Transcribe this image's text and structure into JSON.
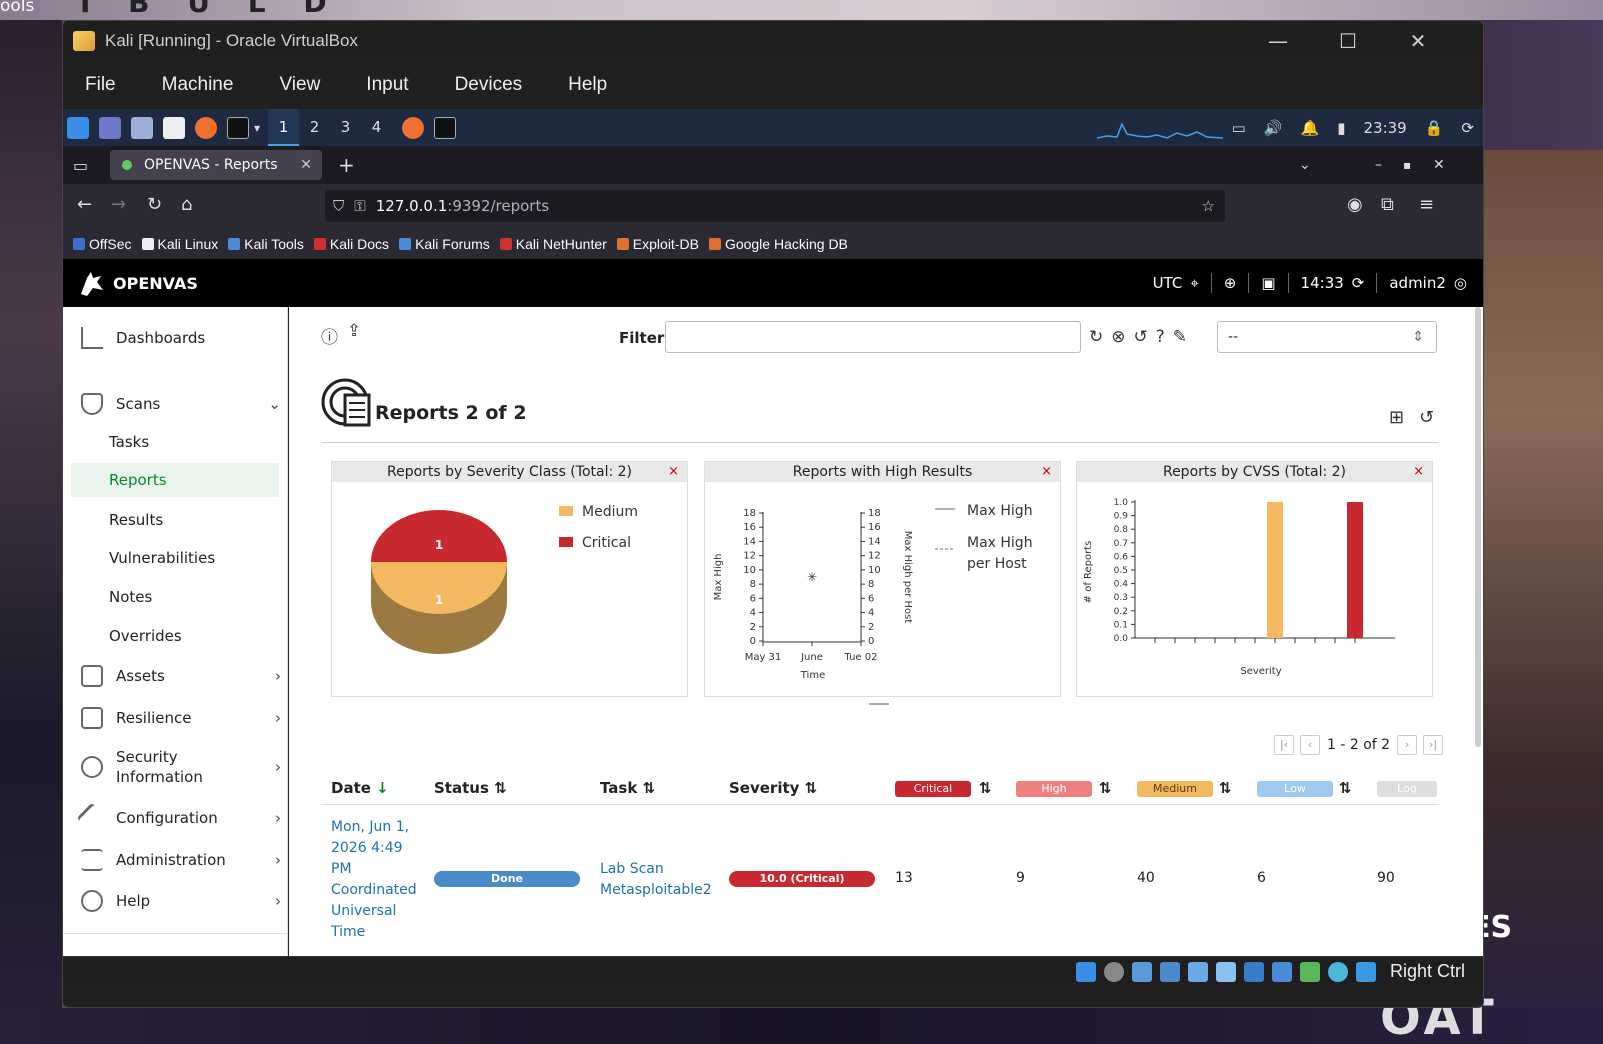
{
  "background": {
    "corner_text": "ools",
    "banner_text": "I B U L D",
    "right_text": "ES",
    "bottom_text": "OAT"
  },
  "window": {
    "title": "Kali [Running] - Oracle VirtualBox",
    "minimize": "—",
    "maximize": "☐",
    "close": "✕"
  },
  "menu": [
    "File",
    "Machine",
    "View",
    "Input",
    "Devices",
    "Help"
  ],
  "kali_panel": {
    "workspaces": [
      "1",
      "2",
      "3",
      "4"
    ],
    "clock": "23:39"
  },
  "browser": {
    "tab_title": "OPENVAS - Reports",
    "tab_close": "✕",
    "new_tab": "+",
    "url_host": "127.0.0.1",
    "url_path": ":9392/reports",
    "bookmarks": [
      {
        "label": "OffSec",
        "color": "#3a6fd0"
      },
      {
        "label": "Kali Linux",
        "color": "#eee"
      },
      {
        "label": "Kali Tools",
        "color": "#4a8ad8"
      },
      {
        "label": "Kali Docs",
        "color": "#d03030"
      },
      {
        "label": "Kali Forums",
        "color": "#4a8ad8"
      },
      {
        "label": "Kali NetHunter",
        "color": "#d03030"
      },
      {
        "label": "Exploit-DB",
        "color": "#e07030"
      },
      {
        "label": "Google Hacking DB",
        "color": "#e07030"
      }
    ]
  },
  "openvas": {
    "brand": "OPENVAS",
    "timezone": "UTC",
    "time": "14:33",
    "user": "admin2"
  },
  "sidebar": {
    "dashboards": "Dashboards",
    "scans": "Scans",
    "scans_sub": [
      "Tasks",
      "Reports",
      "Results",
      "Vulnerabilities",
      "Notes",
      "Overrides"
    ],
    "assets": "Assets",
    "resilience": "Resilience",
    "security_info_1": "Security",
    "security_info_2": "Information",
    "configuration": "Configuration",
    "administration": "Administration",
    "help": "Help"
  },
  "filter": {
    "label": "Filter",
    "value": "",
    "select_value": "--"
  },
  "page": {
    "title": "Reports 2 of 2"
  },
  "panels": {
    "severity": {
      "title": "Reports by Severity Class (Total: 2)",
      "legend": [
        "Medium",
        "Critical"
      ],
      "critical_count": "1",
      "medium_count": "1",
      "close": "×"
    },
    "high": {
      "title": "Reports with High Results",
      "legend": [
        "Max High",
        "Max High",
        "per Host"
      ],
      "ylabel": "Max High",
      "y2label": "Max High per Host",
      "xlabel": "Time",
      "close": "×"
    },
    "cvss": {
      "title": "Reports by CVSS (Total: 2)",
      "ylabel": "# of Reports",
      "xlabel": "Severity",
      "close": "×"
    }
  },
  "chart_data": [
    {
      "type": "pie",
      "title": "Reports by Severity Class (Total: 2)",
      "categories": [
        "Critical",
        "Medium"
      ],
      "values": [
        1,
        1
      ],
      "colors": [
        "#c8282f",
        "#f4b860"
      ],
      "legend": "top-right"
    },
    {
      "type": "line",
      "title": "Reports with High Results",
      "x_ticks": [
        "May 31",
        "June",
        "Tue 02"
      ],
      "y_ticks": [
        0,
        2,
        4,
        6,
        8,
        10,
        12,
        14,
        16,
        18
      ],
      "ylim": [
        0,
        18
      ],
      "xlabel": "Time",
      "ylabel": "Max High",
      "y2label": "Max High per Host",
      "series": [
        {
          "name": "Max High",
          "values": [
            9
          ]
        },
        {
          "name": "Max High per Host",
          "values": [
            9
          ]
        }
      ]
    },
    {
      "type": "bar",
      "title": "Reports by CVSS (Total: 2)",
      "xlabel": "Severity",
      "ylabel": "# of Reports",
      "y_ticks": [
        "0.0",
        "0.1",
        "0.2",
        "0.3",
        "0.4",
        "0.5",
        "0.6",
        "0.7",
        "0.8",
        "0.9",
        "1.0"
      ],
      "ylim": [
        0,
        1
      ],
      "x": [
        0,
        1,
        2,
        3,
        4,
        5,
        6,
        7,
        8,
        9,
        10
      ],
      "values": [
        0,
        0,
        0,
        0,
        0,
        0,
        1,
        0,
        0,
        0,
        1
      ],
      "colors": [
        "#f4b860",
        "#c8282f"
      ]
    }
  ],
  "pagination": {
    "label": "1 - 2 of 2"
  },
  "table": {
    "headers": {
      "date": "Date",
      "status": "Status",
      "task": "Task",
      "severity": "Severity"
    },
    "severity_badges": [
      "Critical",
      "High",
      "Medium",
      "Low",
      "Log"
    ],
    "badge_colors": [
      "#c8282f",
      "#f08080",
      "#f4b860",
      "#a0c8f0",
      "#ddd"
    ],
    "row": {
      "date_lines": [
        "Mon, Jun 1,",
        "2026 4:49",
        "PM",
        "Coordinated",
        "Universal",
        "Time"
      ],
      "status": "Done",
      "task_lines": [
        "Lab Scan",
        "Metasploitable2"
      ],
      "severity": "10.0 (Critical)",
      "critical": "13",
      "high": "9",
      "medium": "40",
      "low": "6",
      "log": "90"
    }
  },
  "vbox_status": {
    "host_key": "Right Ctrl"
  }
}
